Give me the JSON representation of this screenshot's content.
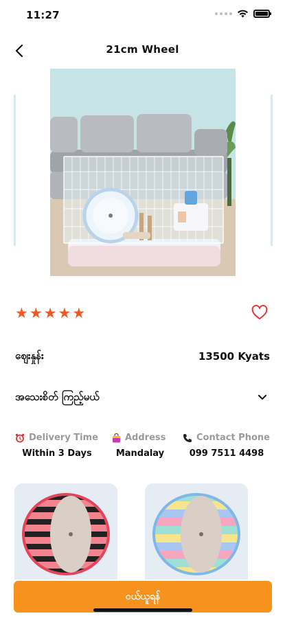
{
  "status_bar": {
    "time": "11:27"
  },
  "nav": {
    "title": "21cm Wheel"
  },
  "product": {
    "rating": 5,
    "rating_max": 5,
    "price_label": "ဈေးနှုန်း",
    "price_value": "13500 Kyats",
    "details_label": "အသေးစိတ် ကြည့်မယ်",
    "favorite": false
  },
  "info": {
    "delivery_label": "Delivery Time",
    "delivery_value": "Within 3 Days",
    "address_label": "Address",
    "address_value": "Mandalay",
    "phone_label": "Contact Phone",
    "phone_value": "099 7511 4498"
  },
  "buy_button": {
    "label": "ဝယ်ယူရန်"
  },
  "colors": {
    "accent": "#f7921e",
    "star": "#f05a22",
    "heart": "#e8323a",
    "muted": "#9b9b9b"
  }
}
